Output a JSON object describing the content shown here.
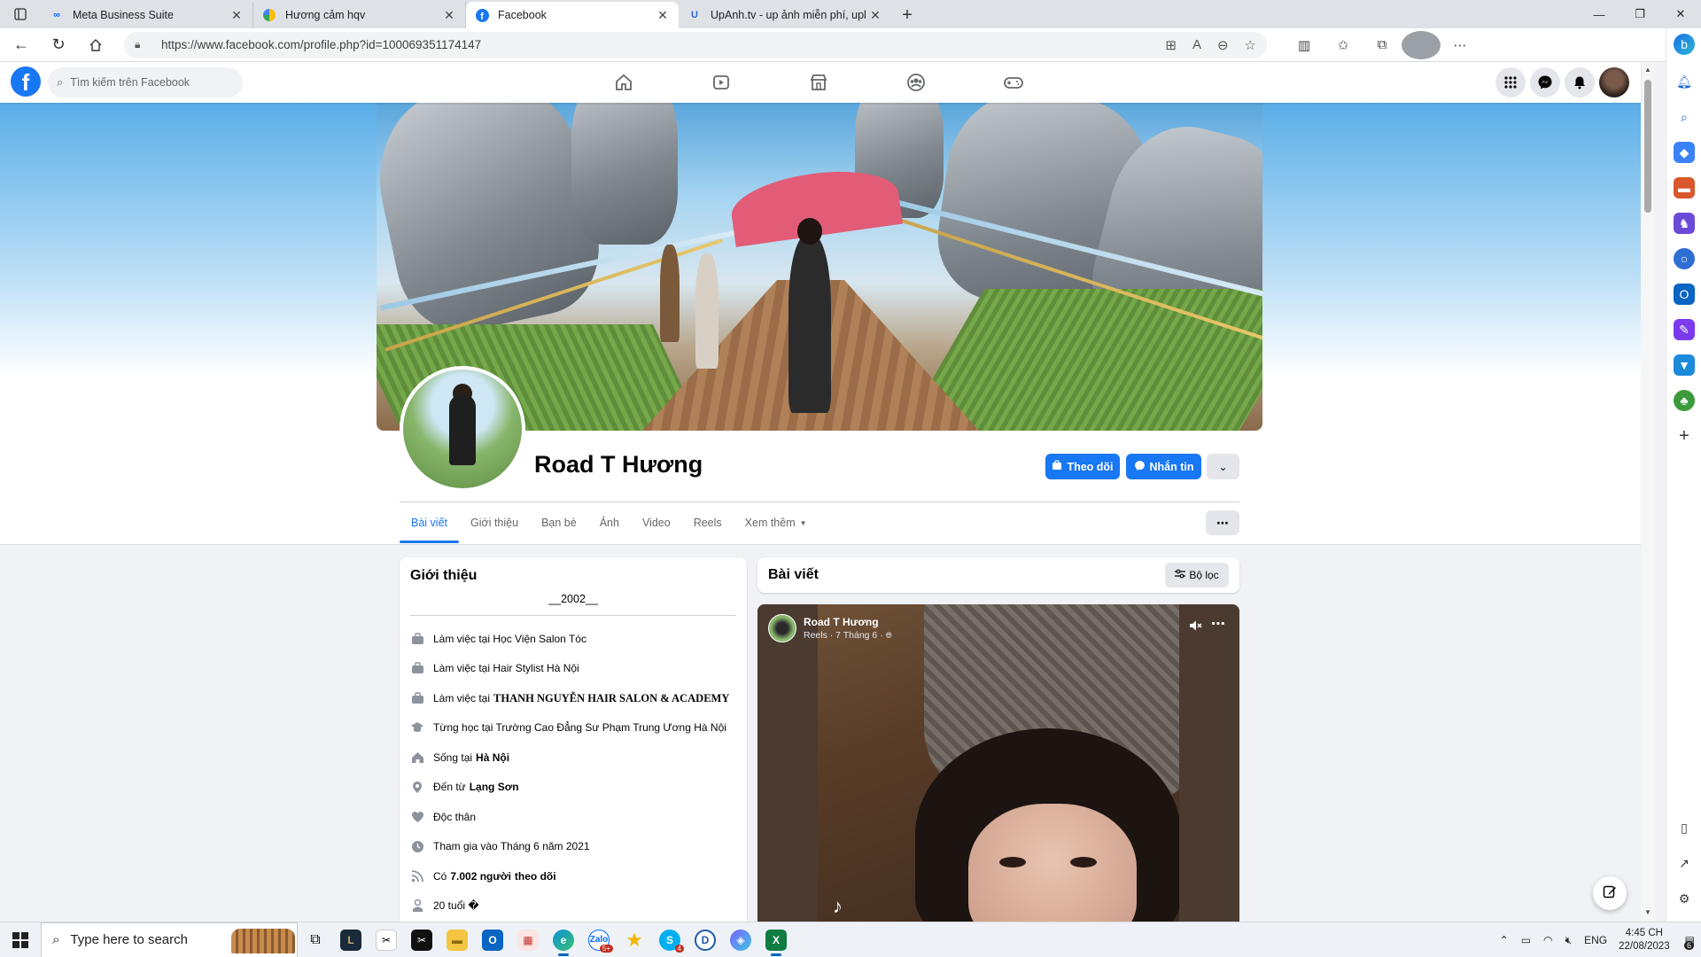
{
  "browser": {
    "tabs": [
      {
        "title": "Meta Business Suite",
        "active": false
      },
      {
        "title": "Hương cảm hqv",
        "active": false
      },
      {
        "title": "Facebook",
        "active": true
      },
      {
        "title": "UpAnh.tv - up ảnh miễn phí, upl",
        "active": false
      }
    ],
    "url": "https://www.facebook.com/profile.php?id=100069351174147"
  },
  "fb": {
    "search_placeholder": "Tìm kiếm trên Facebook",
    "brand_color": "#1877f2"
  },
  "profile": {
    "name": "Road T Hương",
    "follow_label": "Theo dõi",
    "message_label": "Nhắn tin",
    "tabs": [
      "Bài viết",
      "Giới thiệu",
      "Bạn bè",
      "Ảnh",
      "Video",
      "Reels",
      "Xem thêm"
    ]
  },
  "intro": {
    "title": "Giới thiệu",
    "bio": "__2002__",
    "items": [
      {
        "icon": "briefcase-icon",
        "pre": "Làm việc tại Học Viện Salon Tóc",
        "bold": ""
      },
      {
        "icon": "briefcase-icon",
        "pre": "Làm việc tại Hair Stylist Hà Nội",
        "bold": ""
      },
      {
        "icon": "briefcase-icon",
        "pre": "Làm việc tại",
        "bold": "THANH NGUYỄN HAIR SALON & ACADEMY"
      },
      {
        "icon": "graduation-cap-icon",
        "pre": "Từng học tại Trường Cao Đẳng Sư Phạm Trung Ương Hà Nội",
        "bold": ""
      },
      {
        "icon": "home-icon",
        "pre": "Sống tại",
        "bold": "Hà Nội"
      },
      {
        "icon": "location-pin-icon",
        "pre": "Đến từ",
        "bold": "Lạng Sơn"
      },
      {
        "icon": "heart-icon",
        "pre": "Độc thân",
        "bold": ""
      },
      {
        "icon": "clock-icon",
        "pre": "Tham gia vào Tháng 6 năm 2021",
        "bold": ""
      },
      {
        "icon": "rss-icon",
        "pre": "Có",
        "bold": "7.002 người",
        "post": "theo dõi"
      },
      {
        "icon": "birthday-icon",
        "pre": "20 tuổi �",
        "bold": ""
      }
    ]
  },
  "posts": {
    "title": "Bài viết",
    "filter_label": "Bộ lọc",
    "reel": {
      "author": "Road T Hương",
      "meta": "Reels · 7 Tháng 6 ·"
    }
  },
  "taskbar": {
    "search_placeholder": "Type here to search",
    "language": "ENG",
    "time": "4:45 CH",
    "date": "22/08/2023",
    "notification_count": "6"
  }
}
